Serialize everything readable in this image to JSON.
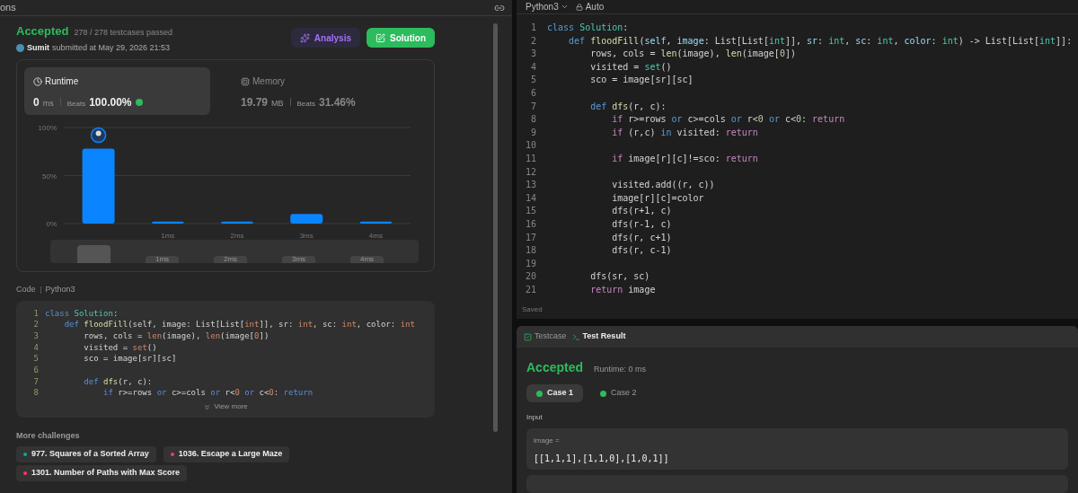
{
  "left_panel": {
    "tab_title": "ons",
    "result": {
      "status": "Accepted",
      "testcases": "278 / 278 testcases passed",
      "user": "Sumit",
      "submitted": "submitted at May 29, 2026 21:53"
    },
    "buttons": [
      {
        "label": "Analysis",
        "kind": "analysis"
      },
      {
        "label": "Solution",
        "kind": "solution"
      }
    ],
    "stats": [
      {
        "label": "Runtime",
        "value": "0",
        "unit": "ms",
        "beats_label": "Beats",
        "beats": "100.00%",
        "selected": true,
        "kind": "runtime"
      },
      {
        "label": "Memory",
        "value": "19.79",
        "unit": "MB",
        "beats_label": "Beats",
        "beats": "31.46%",
        "selected": false,
        "kind": "memory"
      }
    ],
    "chart": {
      "chart_data": {
        "type": "bar",
        "categories": [
          null,
          "1ms",
          "2ms",
          "3ms",
          "4ms"
        ],
        "values": [
          78,
          2,
          2,
          10,
          2
        ],
        "ylim": [
          0,
          100
        ],
        "yticks": [
          {
            "value": 0,
            "label": "0%"
          },
          {
            "value": 50,
            "label": "50%"
          },
          {
            "value": 100,
            "label": "100%"
          }
        ]
      },
      "navigator_labels": [
        "1ms",
        "2ms",
        "3ms",
        "4ms"
      ]
    },
    "code_header": {
      "label": "Code",
      "language": "Python3"
    },
    "code_lines": [
      {
        "number": "1",
        "tokens": [
          {
            "text": "class",
            "kind": "keyword"
          },
          {
            "text": " Solution",
            "kind": "class-name"
          },
          {
            "text": ":",
            "kind": "plain"
          }
        ]
      },
      {
        "number": "2",
        "tokens": [
          {
            "text": "    def",
            "kind": "keyword"
          },
          {
            "text": " floodFill",
            "kind": "func"
          },
          {
            "text": "(self, image: List[List[",
            "kind": "plain"
          },
          {
            "text": "int",
            "kind": "builtin"
          },
          {
            "text": "]], sr: ",
            "kind": "plain"
          },
          {
            "text": "int",
            "kind": "builtin"
          },
          {
            "text": ", sc: ",
            "kind": "plain"
          },
          {
            "text": "int",
            "kind": "builtin"
          },
          {
            "text": ", color: ",
            "kind": "plain"
          },
          {
            "text": "int",
            "kind": "builtin"
          }
        ]
      },
      {
        "number": "3",
        "tokens": [
          {
            "text": "        rows, cols = ",
            "kind": "plain"
          },
          {
            "text": "len",
            "kind": "builtin"
          },
          {
            "text": "(image), ",
            "kind": "plain"
          },
          {
            "text": "len",
            "kind": "builtin"
          },
          {
            "text": "(image[",
            "kind": "plain"
          },
          {
            "text": "0",
            "kind": "number"
          },
          {
            "text": "])",
            "kind": "plain"
          }
        ]
      },
      {
        "number": "4",
        "tokens": [
          {
            "text": "        visited = ",
            "kind": "plain"
          },
          {
            "text": "set",
            "kind": "builtin"
          },
          {
            "text": "()",
            "kind": "plain"
          }
        ]
      },
      {
        "number": "5",
        "tokens": [
          {
            "text": "        sco = image[sr][sc]",
            "kind": "plain"
          }
        ]
      },
      {
        "number": "6"
      },
      {
        "number": "7",
        "tokens": [
          {
            "text": "        def",
            "kind": "keyword"
          },
          {
            "text": " dfs",
            "kind": "func"
          },
          {
            "text": "(r, c):",
            "kind": "plain"
          }
        ]
      },
      {
        "number": "8",
        "tokens": [
          {
            "text": "            if",
            "kind": "keyword"
          },
          {
            "text": " r>=rows ",
            "kind": "plain"
          },
          {
            "text": "or",
            "kind": "keyword"
          },
          {
            "text": " c>=cols ",
            "kind": "plain"
          },
          {
            "text": "or",
            "kind": "keyword"
          },
          {
            "text": " r<",
            "kind": "plain"
          },
          {
            "text": "0",
            "kind": "number"
          },
          {
            "text": " or",
            "kind": "keyword"
          },
          {
            "text": " c<",
            "kind": "plain"
          },
          {
            "text": "0",
            "kind": "number"
          },
          {
            "text": ":",
            "kind": "plain"
          },
          {
            "text": " return",
            "kind": "keyword"
          }
        ]
      }
    ],
    "view_more": "View more",
    "more_challenges": {
      "title": "More challenges",
      "items": [
        {
          "label": "977. Squares of a Sorted Array",
          "color": "#00af9b"
        },
        {
          "label": "1036. Escape a Large Maze",
          "color": "#ff375f"
        },
        {
          "label": "1301. Number of Paths with Max Score",
          "color": "#ff375f"
        }
      ]
    }
  },
  "editor": {
    "language": "Python3",
    "mode": "Auto",
    "status": "Saved",
    "lines": [
      {
        "number": "1",
        "tokens": [
          {
            "text": "class",
            "kind": "keyword"
          },
          {
            "text": " Solution",
            "kind": "class-name"
          },
          {
            "text": ":",
            "kind": "plain"
          }
        ]
      },
      {
        "number": "2",
        "tokens": [
          {
            "text": "    def",
            "kind": "keyword"
          },
          {
            "text": " floodFill",
            "kind": "func"
          },
          {
            "text": "(",
            "kind": "plain"
          },
          {
            "text": "self",
            "kind": "param"
          },
          {
            "text": ",",
            "kind": "plain"
          },
          {
            "text": " image",
            "kind": "param"
          },
          {
            "text": ": List[List[",
            "kind": "plain"
          },
          {
            "text": "int",
            "kind": "type"
          },
          {
            "text": "]],",
            "kind": "plain"
          },
          {
            "text": " sr",
            "kind": "param"
          },
          {
            "text": ":",
            "kind": "plain"
          },
          {
            "text": " int",
            "kind": "type"
          },
          {
            "text": ",",
            "kind": "plain"
          },
          {
            "text": " sc",
            "kind": "param"
          },
          {
            "text": ":",
            "kind": "plain"
          },
          {
            "text": " int",
            "kind": "type"
          },
          {
            "text": ",",
            "kind": "plain"
          },
          {
            "text": " color",
            "kind": "param"
          },
          {
            "text": ":",
            "kind": "plain"
          },
          {
            "text": " int",
            "kind": "type"
          },
          {
            "text": ") -> List[List[",
            "kind": "plain"
          },
          {
            "text": "int",
            "kind": "type"
          },
          {
            "text": "]]:",
            "kind": "plain"
          }
        ]
      },
      {
        "number": "3",
        "tokens": [
          {
            "text": "        rows, cols = ",
            "kind": "plain"
          },
          {
            "text": "len",
            "kind": "func"
          },
          {
            "text": "(image), ",
            "kind": "plain"
          },
          {
            "text": "len",
            "kind": "func"
          },
          {
            "text": "(image[",
            "kind": "plain"
          },
          {
            "text": "0",
            "kind": "number"
          },
          {
            "text": "])",
            "kind": "plain"
          }
        ]
      },
      {
        "number": "4",
        "tokens": [
          {
            "text": "        visited = ",
            "kind": "plain"
          },
          {
            "text": "set",
            "kind": "type"
          },
          {
            "text": "()",
            "kind": "plain"
          }
        ]
      },
      {
        "number": "5",
        "tokens": [
          {
            "text": "        sco = image[sr][sc]",
            "kind": "plain"
          }
        ]
      },
      {
        "number": "6"
      },
      {
        "number": "7",
        "tokens": [
          {
            "text": "        def",
            "kind": "keyword"
          },
          {
            "text": " dfs",
            "kind": "func"
          },
          {
            "text": "(r, c):",
            "kind": "plain"
          }
        ]
      },
      {
        "number": "8",
        "tokens": [
          {
            "text": "            if",
            "kind": "control"
          },
          {
            "text": " r>=rows ",
            "kind": "plain"
          },
          {
            "text": "or",
            "kind": "keyword"
          },
          {
            "text": " c>=cols ",
            "kind": "plain"
          },
          {
            "text": "or",
            "kind": "keyword"
          },
          {
            "text": " r<",
            "kind": "plain"
          },
          {
            "text": "0",
            "kind": "number"
          },
          {
            "text": " or",
            "kind": "keyword"
          },
          {
            "text": " c<",
            "kind": "plain"
          },
          {
            "text": "0",
            "kind": "number"
          },
          {
            "text": ":",
            "kind": "plain"
          },
          {
            "text": " return",
            "kind": "control"
          }
        ]
      },
      {
        "number": "9",
        "tokens": [
          {
            "text": "            if",
            "kind": "control"
          },
          {
            "text": " (r,c) ",
            "kind": "plain"
          },
          {
            "text": "in",
            "kind": "keyword"
          },
          {
            "text": " visited:",
            "kind": "plain"
          },
          {
            "text": " return",
            "kind": "control"
          }
        ]
      },
      {
        "number": "10"
      },
      {
        "number": "11",
        "tokens": [
          {
            "text": "            if",
            "kind": "control"
          },
          {
            "text": " image[r][c]!=sco:",
            "kind": "plain"
          },
          {
            "text": " return",
            "kind": "control"
          }
        ]
      },
      {
        "number": "12"
      },
      {
        "number": "13",
        "tokens": [
          {
            "text": "            visited.add((r, c))",
            "kind": "plain"
          }
        ]
      },
      {
        "number": "14",
        "tokens": [
          {
            "text": "            image[r][c]=color",
            "kind": "plain"
          }
        ]
      },
      {
        "number": "15",
        "tokens": [
          {
            "text": "            dfs(r+1, c)",
            "kind": "plain"
          }
        ]
      },
      {
        "number": "16",
        "tokens": [
          {
            "text": "            dfs(r-1, c)",
            "kind": "plain"
          }
        ]
      },
      {
        "number": "17",
        "tokens": [
          {
            "text": "            dfs(r, c+1)",
            "kind": "plain"
          }
        ]
      },
      {
        "number": "18",
        "tokens": [
          {
            "text": "            dfs(r, c-1)",
            "kind": "plain"
          }
        ]
      },
      {
        "number": "19"
      },
      {
        "number": "20",
        "tokens": [
          {
            "text": "        dfs(sr, sc)",
            "kind": "plain"
          }
        ]
      },
      {
        "number": "21",
        "tokens": [
          {
            "text": "        return",
            "kind": "control"
          },
          {
            "text": " image",
            "kind": "plain"
          }
        ]
      }
    ]
  },
  "result_panel": {
    "tabs": [
      {
        "label": "Testcase",
        "selected": false,
        "kind": "testcase"
      },
      {
        "label": "Test Result",
        "selected": true,
        "kind": "result"
      }
    ],
    "status": "Accepted",
    "runtime": "Runtime: 0 ms",
    "cases": [
      {
        "label": "Case 1",
        "selected": true
      },
      {
        "label": "Case 2",
        "selected": false
      }
    ],
    "input_label": "Input",
    "inputs": [
      {
        "name": "image =",
        "value": "[[1,1,1],[1,1,0],[1,0,1]]"
      }
    ]
  }
}
